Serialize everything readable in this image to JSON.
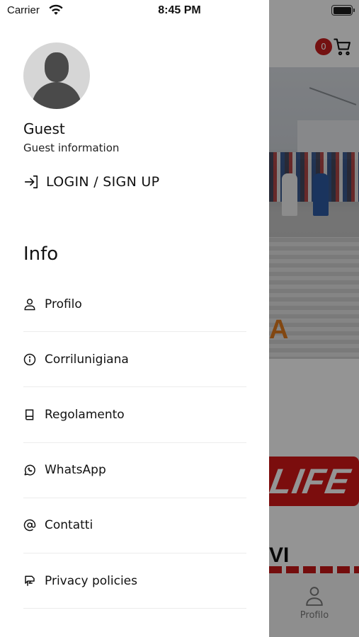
{
  "status_bar": {
    "carrier": "Carrier",
    "time": "8:45 PM"
  },
  "background": {
    "cart_count": "0",
    "photo_overlay_letter": "A",
    "banner_text": "LIFE",
    "section_text": "VI",
    "tab_profile_label": "Profilo"
  },
  "drawer": {
    "user": {
      "name": "Guest",
      "info": "Guest information"
    },
    "login_label": "LOGIN / SIGN UP",
    "section_title": "Info",
    "items": [
      {
        "label": "Profilo",
        "icon": "user-icon"
      },
      {
        "label": "Corrilunigiana",
        "icon": "info-icon"
      },
      {
        "label": "Regolamento",
        "icon": "book-icon"
      },
      {
        "label": "WhatsApp",
        "icon": "whatsapp-icon"
      },
      {
        "label": "Contatti",
        "icon": "at-icon"
      },
      {
        "label": "Privacy policies",
        "icon": "privacy-icon"
      }
    ]
  },
  "colors": {
    "accent_red": "#c81e1e",
    "dim_overlay": "rgba(0,0,0,0.42)"
  }
}
